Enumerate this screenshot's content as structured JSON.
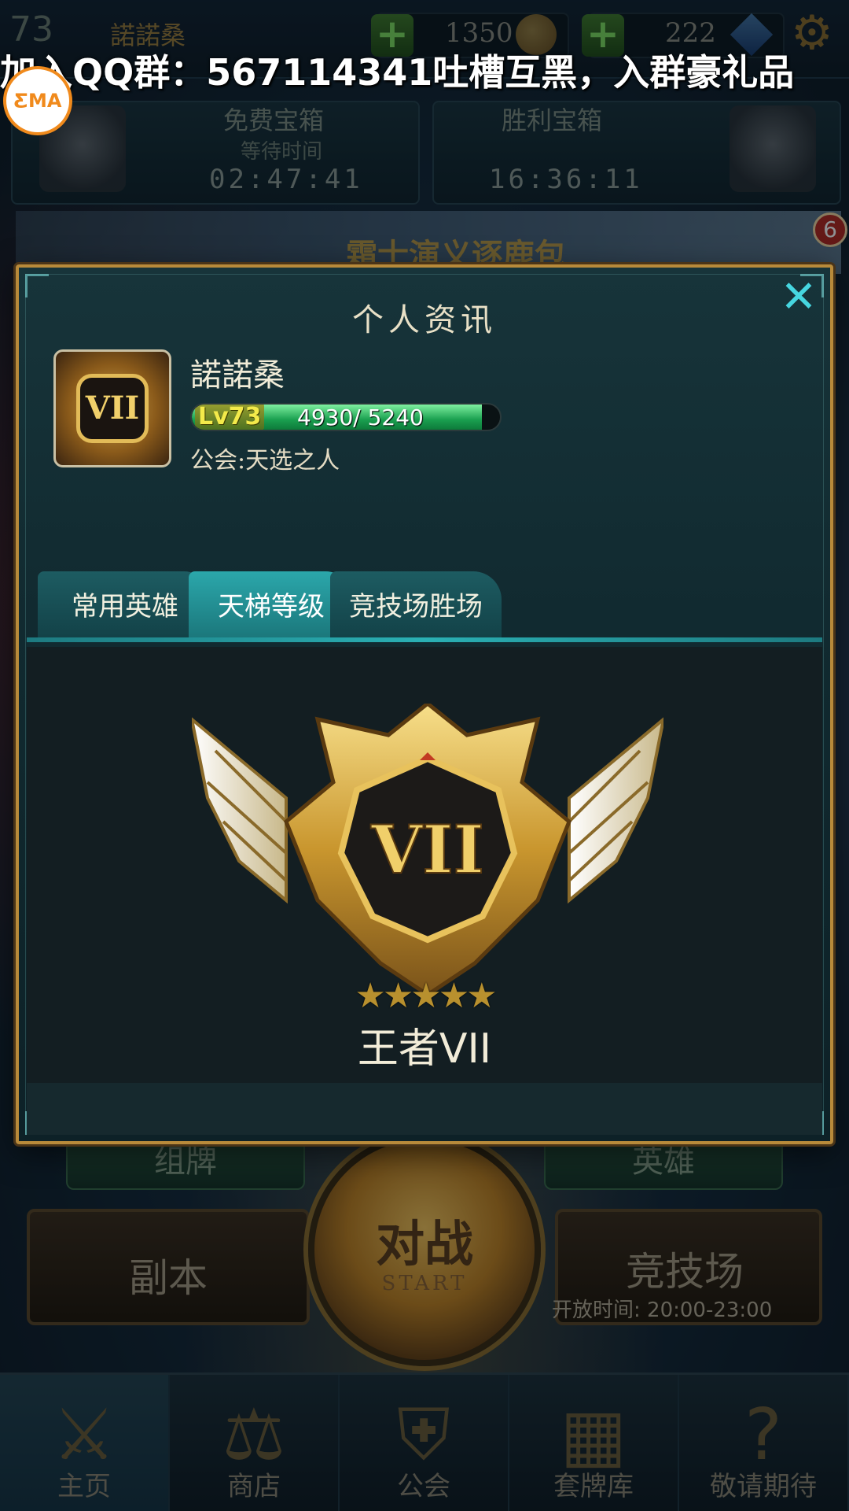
{
  "topbar": {
    "level": "73",
    "name": "諾諾桑",
    "gold": "1350",
    "gems": "222"
  },
  "watermark": {
    "text": "加入QQ群：567114341吐槽互黑，入群豪礼品",
    "logo": "ƸMA"
  },
  "chests": {
    "free": {
      "title": "免费宝箱",
      "sub": "等待时间",
      "time": "02:47:41"
    },
    "victory": {
      "title": "胜利宝箱",
      "time": "16:36:11"
    }
  },
  "event": {
    "text": "霜士演义逐鹿包",
    "badge": "6"
  },
  "modal": {
    "title": "个人资讯",
    "close_icon": "close-icon",
    "player": {
      "name": "諾諾桑",
      "avatar_rank": "VII",
      "level": "Lv73",
      "exp_text": "4930/ 5240",
      "exp_fraction": 0.941,
      "guild": "公会:天选之人"
    },
    "tabs": [
      {
        "label": "常用英雄"
      },
      {
        "label": "天梯等级"
      },
      {
        "label": "竞技场胜场"
      }
    ],
    "active_tab": 1,
    "rank": {
      "numeral": "VII",
      "stars": 5,
      "name": "王者VII"
    }
  },
  "game": {
    "deck_button": "组牌",
    "hero_button": "英雄",
    "battle": "对战",
    "battle_sub": "START",
    "dungeon": "副本",
    "arena": "竞技场",
    "arena_hours": "开放时间:  20:00-23:00"
  },
  "nav": [
    {
      "label": "主页",
      "icon": "swords-icon"
    },
    {
      "label": "商店",
      "icon": "scales-icon"
    },
    {
      "label": "公会",
      "icon": "shield-icon"
    },
    {
      "label": "套牌库",
      "icon": "cards-icon"
    },
    {
      "label": "敬请期待",
      "icon": "question-icon"
    }
  ],
  "colors": {
    "accent_teal": "#2ba7ab",
    "gold_frame": "#b88a3a",
    "close_cyan": "#46d6e0",
    "exp_green": "#1aa050"
  }
}
